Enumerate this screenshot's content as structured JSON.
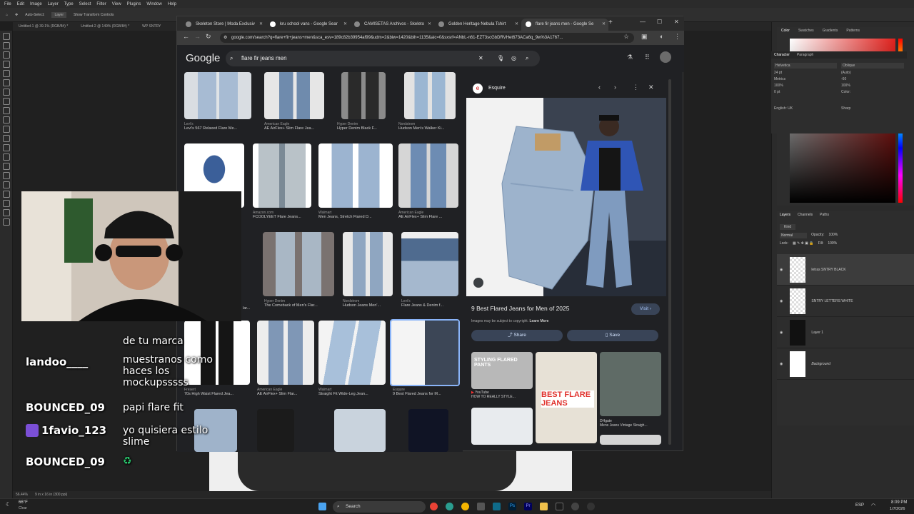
{
  "photoshop": {
    "menu": [
      "File",
      "Edit",
      "Image",
      "Layer",
      "Type",
      "Select",
      "Filter",
      "View",
      "Plugins",
      "Window",
      "Help"
    ],
    "options": [
      "Auto-Select:",
      "Layer",
      "Show Transform Controls"
    ],
    "doc_tabs": [
      "Untitled-1 @ 39.1% (RGB/8#) *",
      "Untitled-2 @ 149% (RGB/8#) *",
      "WP SNTRY"
    ],
    "status": [
      "56.44%",
      "9 in x 16 in (300 ppi)"
    ],
    "character": {
      "tabs": [
        "Character",
        "Paragraph"
      ],
      "font": "Helvetica",
      "style": "Oblique",
      "size": "24 pt",
      "leading": "(Auto)",
      "kerning": "Metrics",
      "tracking": "-60",
      "scale_v": "100%",
      "scale_h": "100%",
      "baseline": "0 pt",
      "color_label": "Color:",
      "language": "English: UK",
      "aa": "Sharp"
    },
    "color_tabs": [
      "Color",
      "Swatches",
      "Gradients",
      "Patterns"
    ],
    "layers": {
      "tabs": [
        "Layers",
        "Channels",
        "Paths"
      ],
      "kind": "Kind",
      "blend": "Normal",
      "opacity_label": "Opacity:",
      "opacity": "100%",
      "lock_label": "Lock:",
      "fill_label": "Fill:",
      "fill": "100%",
      "items": [
        "letras SNTRY BLACK",
        "SNTRY LETTERS WHITE",
        "Layer 1",
        "Background"
      ]
    }
  },
  "taskbar": {
    "weather_temp": "66°F",
    "weather_text": "Clear",
    "search_placeholder": "Search",
    "language": "ESP",
    "time": "8:09 PM",
    "date": "1/7/2026"
  },
  "browser": {
    "tabs": [
      "Skeleton Store | Moda Exclusiv",
      "kru school vans - Google Sear",
      "CAMISETAS Archivos - Skeleto",
      "Golden Heritage Nebula Tshirt",
      "flare fir jeans men - Google Se"
    ],
    "url": "google.com/search?q=flare+fir+jeans+men&sca_esv=189c82b39954af99&udm=2&biw=1420&bih=1135&aic=0&sxsrf=ANbL-n61-EZT3scGbDRVHet673ACa6q_9w%3A1767...",
    "logo": "Google",
    "query": "flare fir jeans men"
  },
  "results": [
    {
      "src": "Levi's",
      "title": "Levi's 567 Relaxed Flare Me..."
    },
    {
      "src": "American Eagle",
      "title": "AE AirFlex+ Slim Flare Jea..."
    },
    {
      "src": "Hyper Denim",
      "title": "Hyper Denim Black F..."
    },
    {
      "src": "Nordstrom",
      "title": "Hudson Men's Walker Ki..."
    },
    {
      "src": "Amazon.com",
      "title": "FCOOLYEET Flare Jeans..."
    },
    {
      "src": "Walmart",
      "title": "Men Jeans, Stretch Flared D..."
    },
    {
      "src": "American Eagle",
      "title": "AE AirFlex+ Slim Flare ..."
    },
    {
      "src": "",
      "title": "lar..."
    },
    {
      "src": "Hyper Denim",
      "title": "The Comeback of Men's Flar..."
    },
    {
      "src": "Nordstrom",
      "title": "Hudson Jeans Men'..."
    },
    {
      "src": "Levi's",
      "title": "Flare Jeans & Denim f..."
    },
    {
      "src": "Fresert",
      "title": "70s High Waist Flared Jea..."
    },
    {
      "src": "American Eagle",
      "title": "AE AirFlex+ Slim Flar..."
    },
    {
      "src": "Walmart",
      "title": "Straight Fit Wide-Leg Jean..."
    },
    {
      "src": "Esquire",
      "title": "9 Best Flared Jeans for M..."
    }
  ],
  "preview": {
    "source": "Esquire",
    "title": "9 Best Flared Jeans for Men of 2025",
    "visit": "Visit",
    "copyright": "Images may be subject to copyright.",
    "learn_more": "Learn More",
    "share": "Share",
    "save": "Save",
    "related": [
      {
        "overlay": "STYLING FLARED PANTS",
        "src": "YouTube",
        "title": "HOW TO REALLY STYLE..."
      },
      {
        "overlay": "BEST FLARE JEANS",
        "src": "",
        "title": ""
      },
      {
        "overlay": "",
        "src": "DHgate",
        "title": "Mens Jeans Vintage Straigh..."
      }
    ]
  },
  "chat": [
    {
      "user": "",
      "msg": "de tu marca"
    },
    {
      "user": "landoo____",
      "msg": "muestranos como haces los mockupsssss"
    },
    {
      "user": "BOUNCED_09",
      "msg": "papi flare fit"
    },
    {
      "user": "1favio_123",
      "msg": "yo quisiera estilo slime"
    },
    {
      "user": "BOUNCED_09",
      "msg": "♻"
    }
  ],
  "colors": {
    "accent_blue": "#a8c7fa",
    "chip_bg": "#394457",
    "page_bg": "#202124",
    "denim_light": "#9db3cc",
    "denim_dark": "#5f7895"
  }
}
